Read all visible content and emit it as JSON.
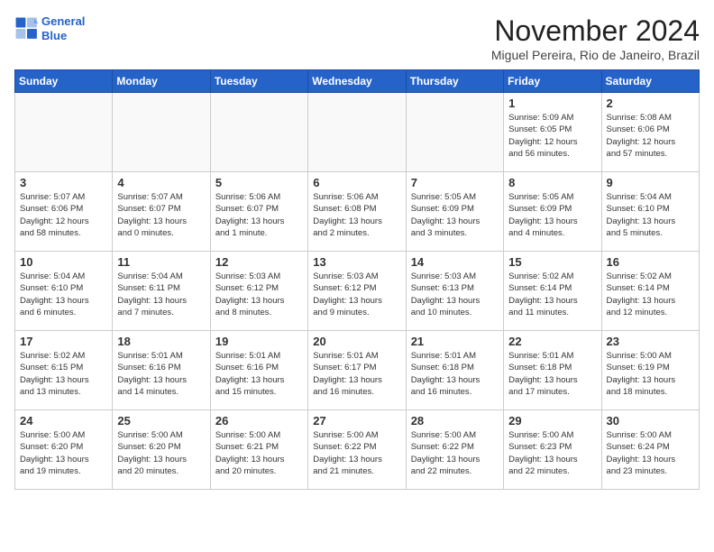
{
  "logo": {
    "line1": "General",
    "line2": "Blue"
  },
  "title": "November 2024",
  "location": "Miguel Pereira, Rio de Janeiro, Brazil",
  "headers": [
    "Sunday",
    "Monday",
    "Tuesday",
    "Wednesday",
    "Thursday",
    "Friday",
    "Saturday"
  ],
  "weeks": [
    [
      {
        "day": "",
        "info": ""
      },
      {
        "day": "",
        "info": ""
      },
      {
        "day": "",
        "info": ""
      },
      {
        "day": "",
        "info": ""
      },
      {
        "day": "",
        "info": ""
      },
      {
        "day": "1",
        "info": "Sunrise: 5:09 AM\nSunset: 6:05 PM\nDaylight: 12 hours\nand 56 minutes."
      },
      {
        "day": "2",
        "info": "Sunrise: 5:08 AM\nSunset: 6:06 PM\nDaylight: 12 hours\nand 57 minutes."
      }
    ],
    [
      {
        "day": "3",
        "info": "Sunrise: 5:07 AM\nSunset: 6:06 PM\nDaylight: 12 hours\nand 58 minutes."
      },
      {
        "day": "4",
        "info": "Sunrise: 5:07 AM\nSunset: 6:07 PM\nDaylight: 13 hours\nand 0 minutes."
      },
      {
        "day": "5",
        "info": "Sunrise: 5:06 AM\nSunset: 6:07 PM\nDaylight: 13 hours\nand 1 minute."
      },
      {
        "day": "6",
        "info": "Sunrise: 5:06 AM\nSunset: 6:08 PM\nDaylight: 13 hours\nand 2 minutes."
      },
      {
        "day": "7",
        "info": "Sunrise: 5:05 AM\nSunset: 6:09 PM\nDaylight: 13 hours\nand 3 minutes."
      },
      {
        "day": "8",
        "info": "Sunrise: 5:05 AM\nSunset: 6:09 PM\nDaylight: 13 hours\nand 4 minutes."
      },
      {
        "day": "9",
        "info": "Sunrise: 5:04 AM\nSunset: 6:10 PM\nDaylight: 13 hours\nand 5 minutes."
      }
    ],
    [
      {
        "day": "10",
        "info": "Sunrise: 5:04 AM\nSunset: 6:10 PM\nDaylight: 13 hours\nand 6 minutes."
      },
      {
        "day": "11",
        "info": "Sunrise: 5:04 AM\nSunset: 6:11 PM\nDaylight: 13 hours\nand 7 minutes."
      },
      {
        "day": "12",
        "info": "Sunrise: 5:03 AM\nSunset: 6:12 PM\nDaylight: 13 hours\nand 8 minutes."
      },
      {
        "day": "13",
        "info": "Sunrise: 5:03 AM\nSunset: 6:12 PM\nDaylight: 13 hours\nand 9 minutes."
      },
      {
        "day": "14",
        "info": "Sunrise: 5:03 AM\nSunset: 6:13 PM\nDaylight: 13 hours\nand 10 minutes."
      },
      {
        "day": "15",
        "info": "Sunrise: 5:02 AM\nSunset: 6:14 PM\nDaylight: 13 hours\nand 11 minutes."
      },
      {
        "day": "16",
        "info": "Sunrise: 5:02 AM\nSunset: 6:14 PM\nDaylight: 13 hours\nand 12 minutes."
      }
    ],
    [
      {
        "day": "17",
        "info": "Sunrise: 5:02 AM\nSunset: 6:15 PM\nDaylight: 13 hours\nand 13 minutes."
      },
      {
        "day": "18",
        "info": "Sunrise: 5:01 AM\nSunset: 6:16 PM\nDaylight: 13 hours\nand 14 minutes."
      },
      {
        "day": "19",
        "info": "Sunrise: 5:01 AM\nSunset: 6:16 PM\nDaylight: 13 hours\nand 15 minutes."
      },
      {
        "day": "20",
        "info": "Sunrise: 5:01 AM\nSunset: 6:17 PM\nDaylight: 13 hours\nand 16 minutes."
      },
      {
        "day": "21",
        "info": "Sunrise: 5:01 AM\nSunset: 6:18 PM\nDaylight: 13 hours\nand 16 minutes."
      },
      {
        "day": "22",
        "info": "Sunrise: 5:01 AM\nSunset: 6:18 PM\nDaylight: 13 hours\nand 17 minutes."
      },
      {
        "day": "23",
        "info": "Sunrise: 5:00 AM\nSunset: 6:19 PM\nDaylight: 13 hours\nand 18 minutes."
      }
    ],
    [
      {
        "day": "24",
        "info": "Sunrise: 5:00 AM\nSunset: 6:20 PM\nDaylight: 13 hours\nand 19 minutes."
      },
      {
        "day": "25",
        "info": "Sunrise: 5:00 AM\nSunset: 6:20 PM\nDaylight: 13 hours\nand 20 minutes."
      },
      {
        "day": "26",
        "info": "Sunrise: 5:00 AM\nSunset: 6:21 PM\nDaylight: 13 hours\nand 20 minutes."
      },
      {
        "day": "27",
        "info": "Sunrise: 5:00 AM\nSunset: 6:22 PM\nDaylight: 13 hours\nand 21 minutes."
      },
      {
        "day": "28",
        "info": "Sunrise: 5:00 AM\nSunset: 6:22 PM\nDaylight: 13 hours\nand 22 minutes."
      },
      {
        "day": "29",
        "info": "Sunrise: 5:00 AM\nSunset: 6:23 PM\nDaylight: 13 hours\nand 22 minutes."
      },
      {
        "day": "30",
        "info": "Sunrise: 5:00 AM\nSunset: 6:24 PM\nDaylight: 13 hours\nand 23 minutes."
      }
    ]
  ]
}
